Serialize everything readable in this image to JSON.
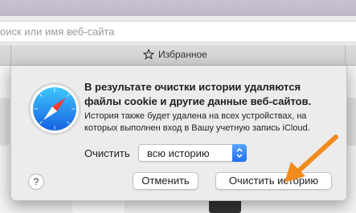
{
  "browser": {
    "address_placeholder": "оиск или имя веб-сайта",
    "favorites_tab": "Избранное"
  },
  "dialog": {
    "title": "В результате очистки истории удаляются файлы cookie и другие данные веб-сайтов.",
    "body": "История также будет удалена на всех устройствах, на которых выполнен вход в Вашу учетную запись iCloud.",
    "clear_label": "Очистить",
    "range_selected": "всю историю",
    "help_label": "?",
    "cancel_label": "Отменить",
    "confirm_label": "Очистить историю"
  },
  "colors": {
    "accent": "#1d6ff0",
    "annotation_arrow": "#f08c1e"
  },
  "icons": [
    "safari-compass-icon",
    "star-icon",
    "chevron-updown-icon",
    "arrow-icon"
  ]
}
